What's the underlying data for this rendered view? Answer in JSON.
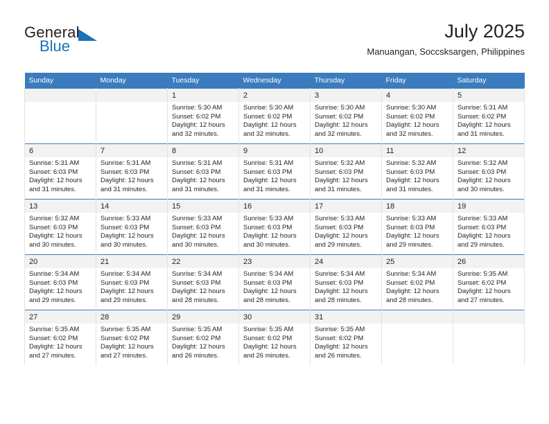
{
  "brand": {
    "word1": "General",
    "word2": "Blue",
    "triangle_color": "#1b72b8",
    "logo_icon": "triangle-flag-icon"
  },
  "header": {
    "title": "July 2025",
    "subtitle": "Manuangan, Soccsksargen, Philippines"
  },
  "theme": {
    "header_bg": "#3a7cbe",
    "daynum_bg": "#f2f2f2",
    "grid_line": "#e2e2e2",
    "text": "#231f20"
  },
  "calendar": {
    "weekday_headers": [
      "Sunday",
      "Monday",
      "Tuesday",
      "Wednesday",
      "Thursday",
      "Friday",
      "Saturday"
    ],
    "weeks": [
      [
        {
          "day": "",
          "sunrise": "",
          "sunset": "",
          "daylight1": "",
          "daylight2": ""
        },
        {
          "day": "",
          "sunrise": "",
          "sunset": "",
          "daylight1": "",
          "daylight2": ""
        },
        {
          "day": "1",
          "sunrise": "Sunrise: 5:30 AM",
          "sunset": "Sunset: 6:02 PM",
          "daylight1": "Daylight: 12 hours",
          "daylight2": "and 32 minutes."
        },
        {
          "day": "2",
          "sunrise": "Sunrise: 5:30 AM",
          "sunset": "Sunset: 6:02 PM",
          "daylight1": "Daylight: 12 hours",
          "daylight2": "and 32 minutes."
        },
        {
          "day": "3",
          "sunrise": "Sunrise: 5:30 AM",
          "sunset": "Sunset: 6:02 PM",
          "daylight1": "Daylight: 12 hours",
          "daylight2": "and 32 minutes."
        },
        {
          "day": "4",
          "sunrise": "Sunrise: 5:30 AM",
          "sunset": "Sunset: 6:02 PM",
          "daylight1": "Daylight: 12 hours",
          "daylight2": "and 32 minutes."
        },
        {
          "day": "5",
          "sunrise": "Sunrise: 5:31 AM",
          "sunset": "Sunset: 6:02 PM",
          "daylight1": "Daylight: 12 hours",
          "daylight2": "and 31 minutes."
        }
      ],
      [
        {
          "day": "6",
          "sunrise": "Sunrise: 5:31 AM",
          "sunset": "Sunset: 6:03 PM",
          "daylight1": "Daylight: 12 hours",
          "daylight2": "and 31 minutes."
        },
        {
          "day": "7",
          "sunrise": "Sunrise: 5:31 AM",
          "sunset": "Sunset: 6:03 PM",
          "daylight1": "Daylight: 12 hours",
          "daylight2": "and 31 minutes."
        },
        {
          "day": "8",
          "sunrise": "Sunrise: 5:31 AM",
          "sunset": "Sunset: 6:03 PM",
          "daylight1": "Daylight: 12 hours",
          "daylight2": "and 31 minutes."
        },
        {
          "day": "9",
          "sunrise": "Sunrise: 5:31 AM",
          "sunset": "Sunset: 6:03 PM",
          "daylight1": "Daylight: 12 hours",
          "daylight2": "and 31 minutes."
        },
        {
          "day": "10",
          "sunrise": "Sunrise: 5:32 AM",
          "sunset": "Sunset: 6:03 PM",
          "daylight1": "Daylight: 12 hours",
          "daylight2": "and 31 minutes."
        },
        {
          "day": "11",
          "sunrise": "Sunrise: 5:32 AM",
          "sunset": "Sunset: 6:03 PM",
          "daylight1": "Daylight: 12 hours",
          "daylight2": "and 31 minutes."
        },
        {
          "day": "12",
          "sunrise": "Sunrise: 5:32 AM",
          "sunset": "Sunset: 6:03 PM",
          "daylight1": "Daylight: 12 hours",
          "daylight2": "and 30 minutes."
        }
      ],
      [
        {
          "day": "13",
          "sunrise": "Sunrise: 5:32 AM",
          "sunset": "Sunset: 6:03 PM",
          "daylight1": "Daylight: 12 hours",
          "daylight2": "and 30 minutes."
        },
        {
          "day": "14",
          "sunrise": "Sunrise: 5:33 AM",
          "sunset": "Sunset: 6:03 PM",
          "daylight1": "Daylight: 12 hours",
          "daylight2": "and 30 minutes."
        },
        {
          "day": "15",
          "sunrise": "Sunrise: 5:33 AM",
          "sunset": "Sunset: 6:03 PM",
          "daylight1": "Daylight: 12 hours",
          "daylight2": "and 30 minutes."
        },
        {
          "day": "16",
          "sunrise": "Sunrise: 5:33 AM",
          "sunset": "Sunset: 6:03 PM",
          "daylight1": "Daylight: 12 hours",
          "daylight2": "and 30 minutes."
        },
        {
          "day": "17",
          "sunrise": "Sunrise: 5:33 AM",
          "sunset": "Sunset: 6:03 PM",
          "daylight1": "Daylight: 12 hours",
          "daylight2": "and 29 minutes."
        },
        {
          "day": "18",
          "sunrise": "Sunrise: 5:33 AM",
          "sunset": "Sunset: 6:03 PM",
          "daylight1": "Daylight: 12 hours",
          "daylight2": "and 29 minutes."
        },
        {
          "day": "19",
          "sunrise": "Sunrise: 5:33 AM",
          "sunset": "Sunset: 6:03 PM",
          "daylight1": "Daylight: 12 hours",
          "daylight2": "and 29 minutes."
        }
      ],
      [
        {
          "day": "20",
          "sunrise": "Sunrise: 5:34 AM",
          "sunset": "Sunset: 6:03 PM",
          "daylight1": "Daylight: 12 hours",
          "daylight2": "and 29 minutes."
        },
        {
          "day": "21",
          "sunrise": "Sunrise: 5:34 AM",
          "sunset": "Sunset: 6:03 PM",
          "daylight1": "Daylight: 12 hours",
          "daylight2": "and 29 minutes."
        },
        {
          "day": "22",
          "sunrise": "Sunrise: 5:34 AM",
          "sunset": "Sunset: 6:03 PM",
          "daylight1": "Daylight: 12 hours",
          "daylight2": "and 28 minutes."
        },
        {
          "day": "23",
          "sunrise": "Sunrise: 5:34 AM",
          "sunset": "Sunset: 6:03 PM",
          "daylight1": "Daylight: 12 hours",
          "daylight2": "and 28 minutes."
        },
        {
          "day": "24",
          "sunrise": "Sunrise: 5:34 AM",
          "sunset": "Sunset: 6:03 PM",
          "daylight1": "Daylight: 12 hours",
          "daylight2": "and 28 minutes."
        },
        {
          "day": "25",
          "sunrise": "Sunrise: 5:34 AM",
          "sunset": "Sunset: 6:02 PM",
          "daylight1": "Daylight: 12 hours",
          "daylight2": "and 28 minutes."
        },
        {
          "day": "26",
          "sunrise": "Sunrise: 5:35 AM",
          "sunset": "Sunset: 6:02 PM",
          "daylight1": "Daylight: 12 hours",
          "daylight2": "and 27 minutes."
        }
      ],
      [
        {
          "day": "27",
          "sunrise": "Sunrise: 5:35 AM",
          "sunset": "Sunset: 6:02 PM",
          "daylight1": "Daylight: 12 hours",
          "daylight2": "and 27 minutes."
        },
        {
          "day": "28",
          "sunrise": "Sunrise: 5:35 AM",
          "sunset": "Sunset: 6:02 PM",
          "daylight1": "Daylight: 12 hours",
          "daylight2": "and 27 minutes."
        },
        {
          "day": "29",
          "sunrise": "Sunrise: 5:35 AM",
          "sunset": "Sunset: 6:02 PM",
          "daylight1": "Daylight: 12 hours",
          "daylight2": "and 26 minutes."
        },
        {
          "day": "30",
          "sunrise": "Sunrise: 5:35 AM",
          "sunset": "Sunset: 6:02 PM",
          "daylight1": "Daylight: 12 hours",
          "daylight2": "and 26 minutes."
        },
        {
          "day": "31",
          "sunrise": "Sunrise: 5:35 AM",
          "sunset": "Sunset: 6:02 PM",
          "daylight1": "Daylight: 12 hours",
          "daylight2": "and 26 minutes."
        },
        {
          "day": "",
          "sunrise": "",
          "sunset": "",
          "daylight1": "",
          "daylight2": ""
        },
        {
          "day": "",
          "sunrise": "",
          "sunset": "",
          "daylight1": "",
          "daylight2": ""
        }
      ]
    ]
  }
}
